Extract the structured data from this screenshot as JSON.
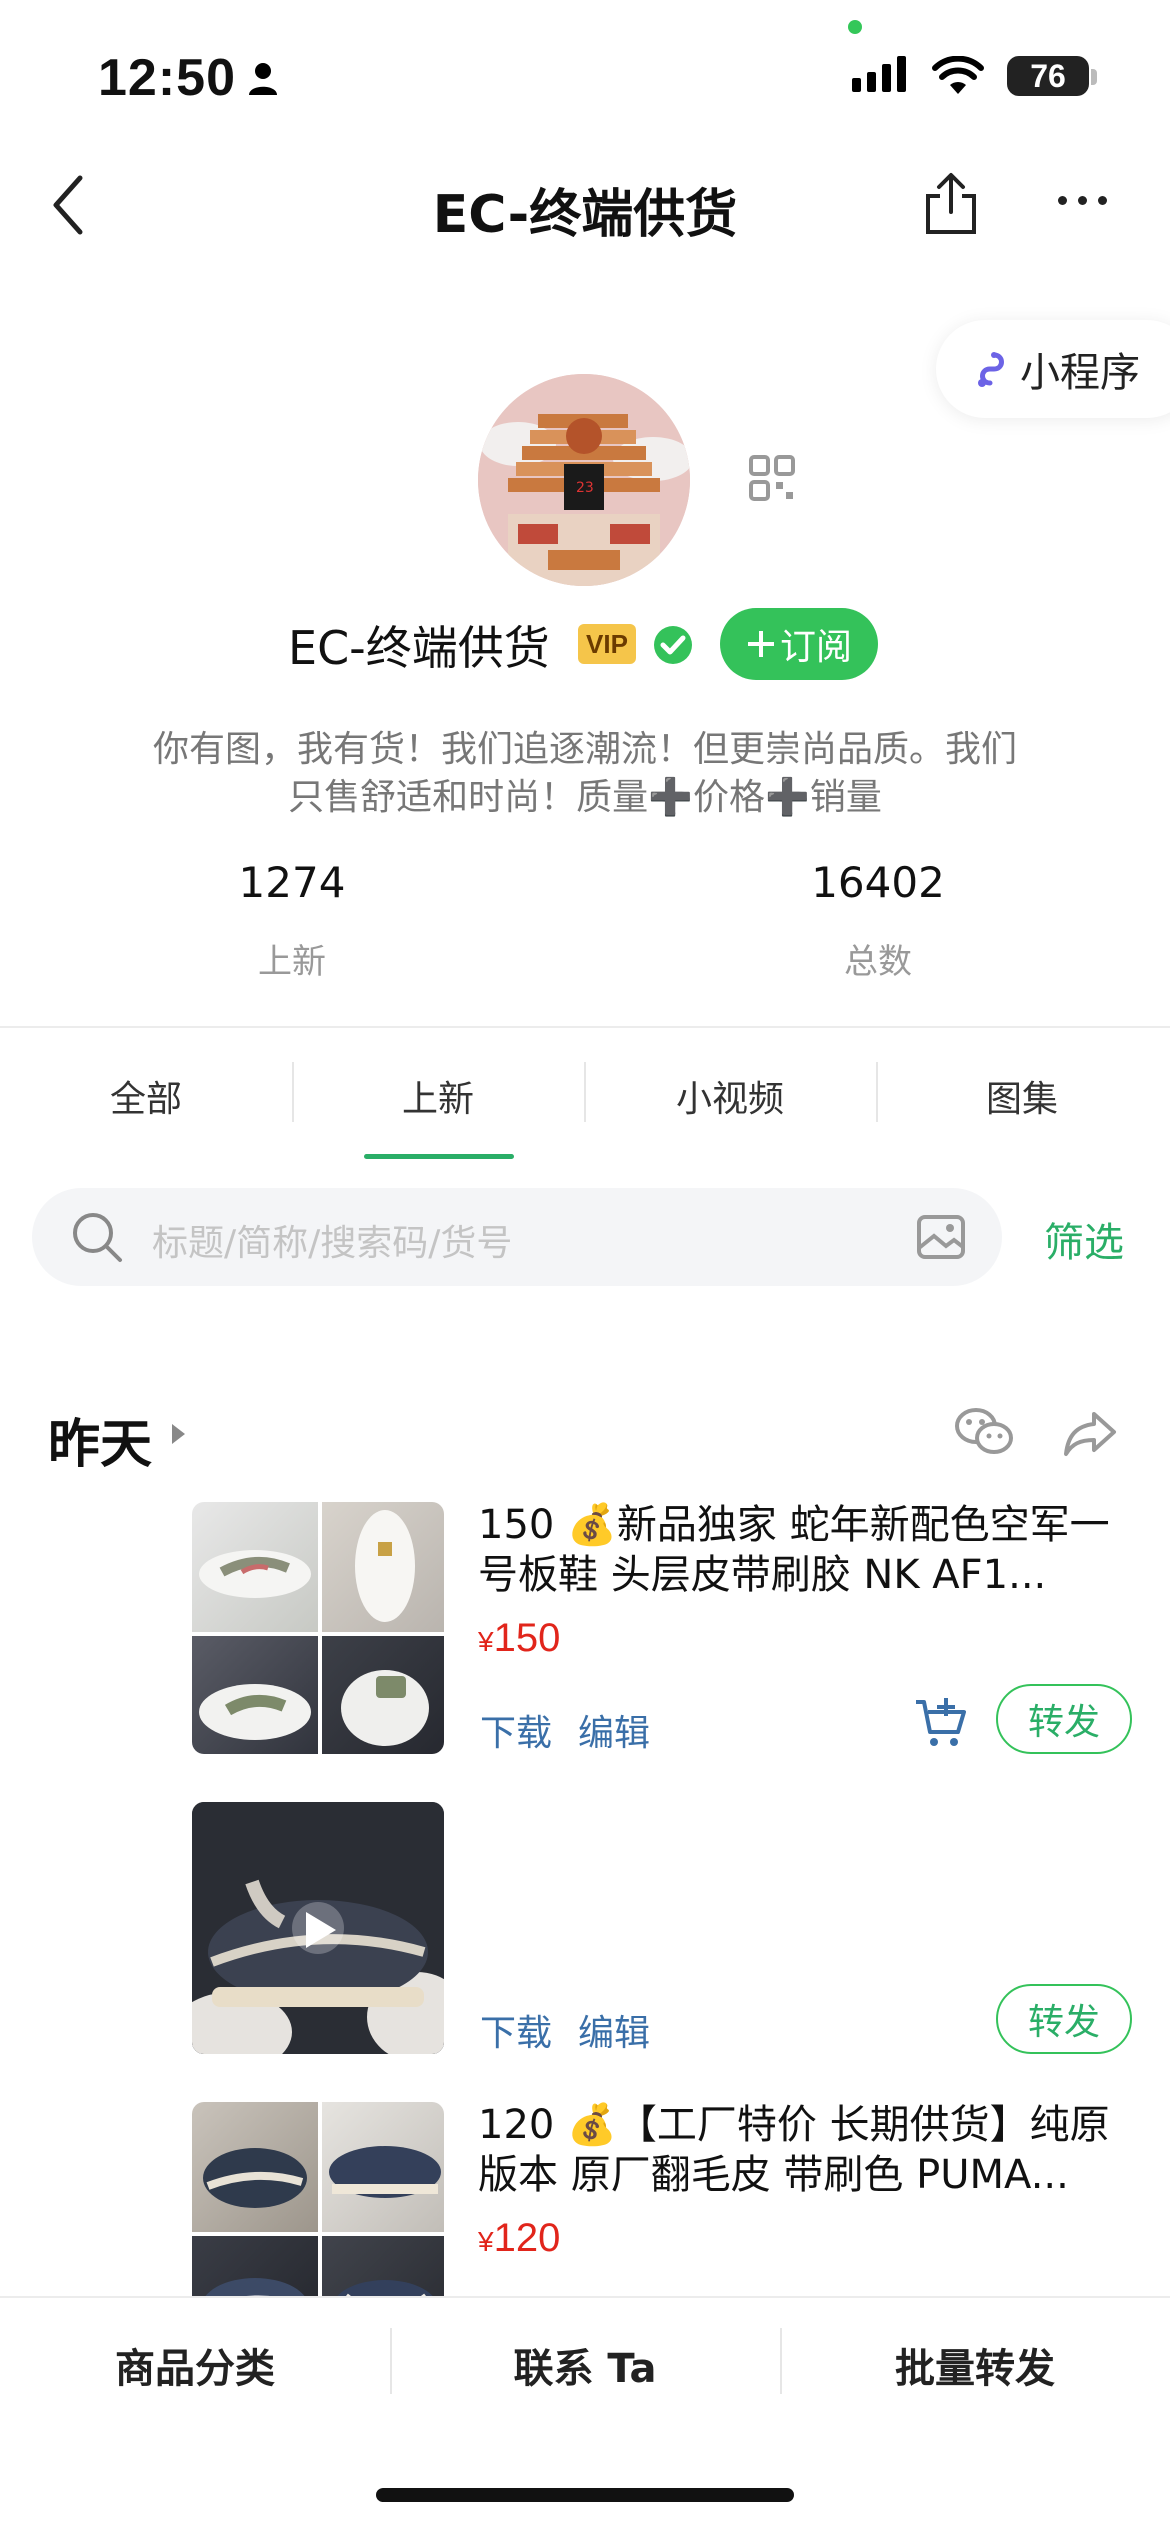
{
  "status_bar": {
    "time": "12:50",
    "battery": "76"
  },
  "nav": {
    "title": "EC-终端供货"
  },
  "mini_program": {
    "label": "小程序"
  },
  "profile": {
    "name": "EC-终端供货",
    "vip": "VIP",
    "subscribe_label": "订阅",
    "bio": "你有图，我有货！我们追逐潮流！但更崇尚品质。我们只售舒适和时尚！质量➕价格➕销量",
    "stats": [
      {
        "value": "1274",
        "label": "上新"
      },
      {
        "value": "16402",
        "label": "总数"
      }
    ]
  },
  "tabs": [
    {
      "label": "全部"
    },
    {
      "label": "上新",
      "active": true
    },
    {
      "label": "小视频"
    },
    {
      "label": "图集"
    }
  ],
  "search": {
    "placeholder": "标题/简称/搜索码/货号",
    "filter_label": "筛选"
  },
  "section": {
    "title": "昨天"
  },
  "products": [
    {
      "title": "150 💰新品独家 蛇年新配色空军一号板鞋 头层皮带刷胶 NK AF1...",
      "price_symbol": "¥",
      "price": "150",
      "download": "下载",
      "edit": "编辑",
      "forward": "转发",
      "media": "images"
    },
    {
      "title": "",
      "download": "下载",
      "edit": "编辑",
      "forward": "转发",
      "media": "video"
    },
    {
      "title": "120 💰【工厂特价 长期供货】纯原版本 原厂翻毛皮 带刷色 PUMA...",
      "price_symbol": "¥",
      "price": "120",
      "media": "images"
    }
  ],
  "bottom_bar": {
    "category": "商品分类",
    "contact": "联系 Ta",
    "batch_forward": "批量转发"
  },
  "colors": {
    "accent_green": "#2aae67",
    "price_red": "#e1251b",
    "link_blue": "#3a6fa8"
  }
}
